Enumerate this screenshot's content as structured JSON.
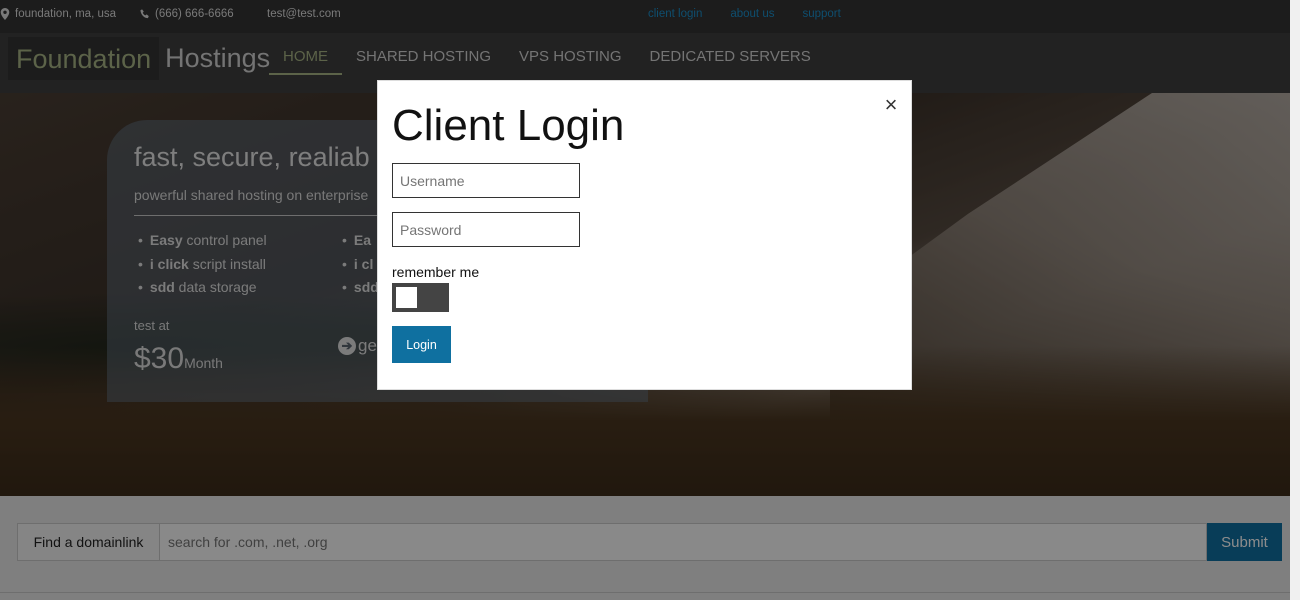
{
  "topbar": {
    "address": "foundation, ma, usa",
    "phone": "(666) 666-6666",
    "email": "test@test.com",
    "links": [
      "client login",
      "about us",
      "support"
    ]
  },
  "brand": {
    "part1": "Foundation",
    "part2": "Hostings"
  },
  "nav": {
    "items": [
      "HOME",
      "SHARED HOSTING",
      "VPS HOSTING",
      "DEDICATED SERVERS"
    ],
    "active": "HOME"
  },
  "promo": {
    "title": "fast, secure, realiab",
    "subtitle": "powerful shared hosting on enterprise",
    "col1": [
      {
        "bold": "Easy",
        "rest": " control panel"
      },
      {
        "bold": "i click",
        "rest": " script install"
      },
      {
        "bold": "sdd",
        "rest": " data storage"
      }
    ],
    "col2": [
      {
        "bold": "Ea",
        "rest": ""
      },
      {
        "bold": "i cl",
        "rest": ""
      },
      {
        "bold": "sdd",
        "rest": ""
      }
    ],
    "test_at": "test at",
    "price": "$30",
    "price_unit": "Month",
    "cta": "ge"
  },
  "domain": {
    "label": "Find a domainlink",
    "placeholder": "search for .com, .net, .org",
    "submit": "Submit"
  },
  "modal": {
    "title": "Client Login",
    "close": "×",
    "username_placeholder": "Username",
    "password_placeholder": "Password",
    "remember": "remember me",
    "remember_on": false,
    "login": "Login"
  },
  "colors": {
    "accent": "#0f70a0",
    "brand_green": "#a8b586",
    "link_blue": "#1b8ec9",
    "topbar_bg": "#333333",
    "navbar_bg": "#3e3e3e"
  },
  "icons": [
    "map-marker-icon",
    "phone-icon",
    "arrow-circle-right-icon",
    "close-icon"
  ]
}
